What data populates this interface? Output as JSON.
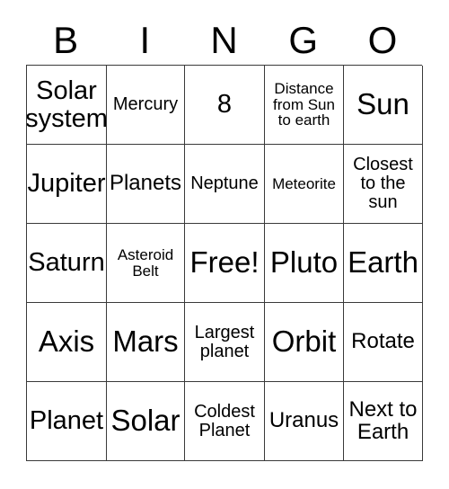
{
  "card": {
    "title_letters": [
      "B",
      "I",
      "N",
      "G",
      "O"
    ],
    "free_space_label": "Free!",
    "grid": [
      [
        {
          "text": "Solar system",
          "size": "lg"
        },
        {
          "text": "Mercury",
          "size": "sm"
        },
        {
          "text": "8",
          "size": "lg"
        },
        {
          "text": "Distance from Sun to earth",
          "size": "xs"
        },
        {
          "text": "Sun",
          "size": "xl"
        }
      ],
      [
        {
          "text": "Jupiter",
          "size": "lg"
        },
        {
          "text": "Planets",
          "size": "md"
        },
        {
          "text": "Neptune",
          "size": "sm"
        },
        {
          "text": "Meteorite",
          "size": "xs"
        },
        {
          "text": "Closest to the sun",
          "size": "sm"
        }
      ],
      [
        {
          "text": "Saturn",
          "size": "lg"
        },
        {
          "text": "Asteroid Belt",
          "size": "xs"
        },
        {
          "text": "Free!",
          "size": "xl"
        },
        {
          "text": "Pluto",
          "size": "xl"
        },
        {
          "text": "Earth",
          "size": "xl"
        }
      ],
      [
        {
          "text": "Axis",
          "size": "xl"
        },
        {
          "text": "Mars",
          "size": "xl"
        },
        {
          "text": "Largest planet",
          "size": "sm"
        },
        {
          "text": "Orbit",
          "size": "xl"
        },
        {
          "text": "Rotate",
          "size": "md"
        }
      ],
      [
        {
          "text": "Planet",
          "size": "lg"
        },
        {
          "text": "Solar",
          "size": "xl"
        },
        {
          "text": "Coldest Planet",
          "size": "sm"
        },
        {
          "text": "Uranus",
          "size": "md"
        },
        {
          "text": "Next to Earth",
          "size": "md"
        }
      ]
    ],
    "colors": {
      "background": "#ffffff",
      "text": "#000000",
      "border": "#3a3a3a"
    }
  }
}
